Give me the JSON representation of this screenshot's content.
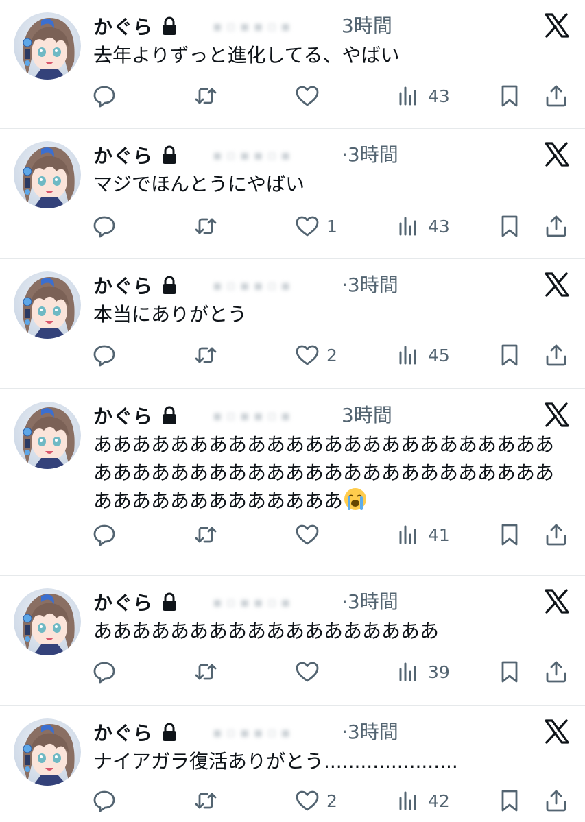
{
  "colors": {
    "text": "#0f1419",
    "muted": "#536471",
    "divider": "#e6e9eb"
  },
  "tweets": [
    {
      "name": "かぐら",
      "time": "3時間",
      "text": "去年よりずっと進化してる、やばい",
      "replies": "",
      "retweets": "",
      "likes": "",
      "views": "43"
    },
    {
      "name": "かぐら",
      "time": "·3時間",
      "text": "マジでほんとうにやばい",
      "replies": "",
      "retweets": "",
      "likes": "1",
      "views": "43"
    },
    {
      "name": "かぐら",
      "time": "·3時間",
      "text": "本当にありがとう",
      "replies": "",
      "retweets": "",
      "likes": "2",
      "views": "45"
    },
    {
      "name": "かぐら",
      "time": "3時間",
      "text": "あああああああああああああああああああああああああああああああああああああああああああああああああああああああああああああ",
      "emoji": "loudly-crying-face",
      "replies": "",
      "retweets": "",
      "likes": "",
      "views": "41"
    },
    {
      "name": "かぐら",
      "time": "·3時間",
      "text": "ああああああああああああああああああ",
      "replies": "",
      "retweets": "",
      "likes": "",
      "views": "39"
    },
    {
      "name": "かぐら",
      "time": "·3時間",
      "text": "ナイアガラ復活ありがとう......................",
      "replies": "",
      "retweets": "",
      "likes": "2",
      "views": "42"
    }
  ],
  "icons": {
    "lock": "lock-icon",
    "x": "x-logo-icon",
    "reply": "reply-icon",
    "retweet": "retweet-icon",
    "like": "heart-icon",
    "views": "views-bar-chart-icon",
    "bookmark": "bookmark-icon",
    "share": "share-icon"
  }
}
